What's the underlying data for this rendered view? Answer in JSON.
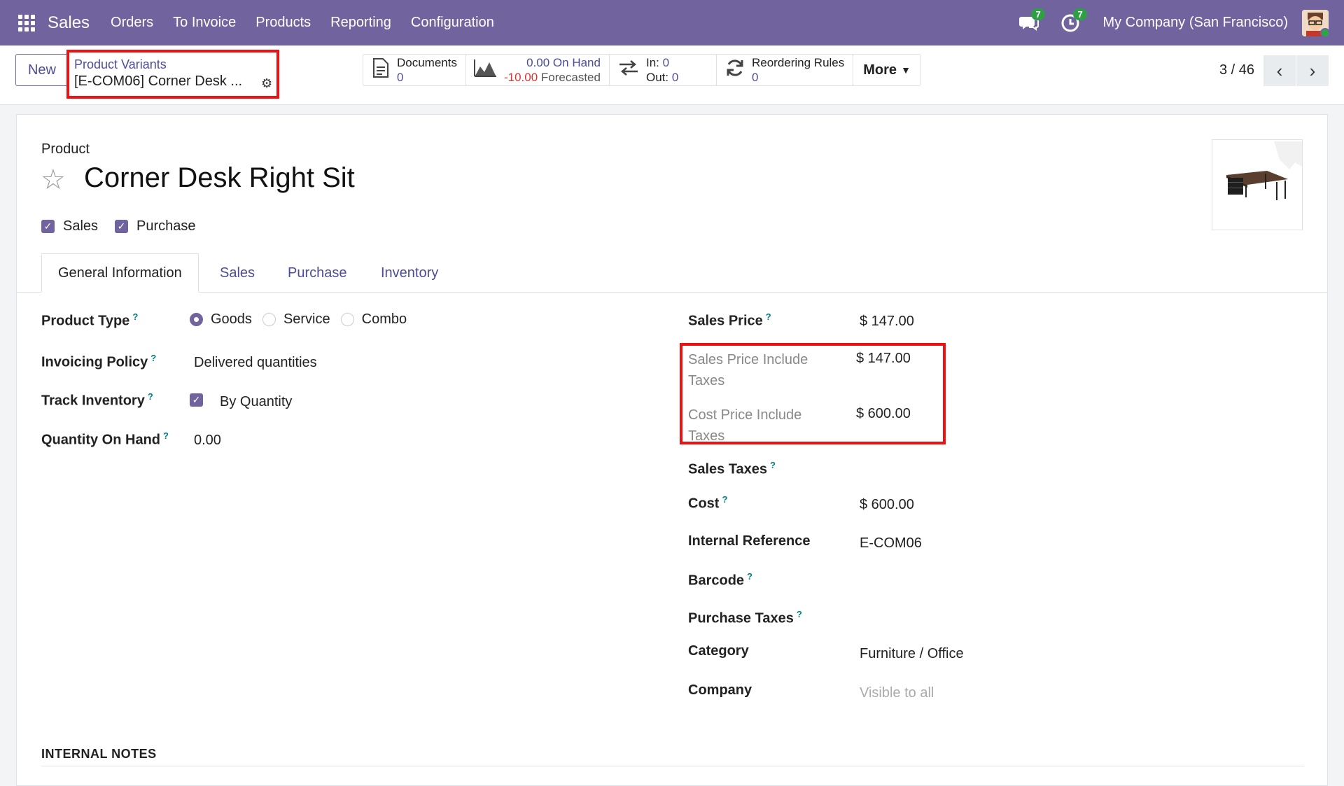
{
  "navbar": {
    "app_name": "Sales",
    "menu": [
      "Orders",
      "To Invoice",
      "Products",
      "Reporting",
      "Configuration"
    ],
    "messages_count": "7",
    "activities_count": "7",
    "company": "My Company (San Francisco)"
  },
  "control": {
    "new_label": "New",
    "breadcrumb_parent": "Product Variants",
    "breadcrumb_current": "[E-COM06] Corner Desk ...",
    "stats": {
      "documents_label": "Documents",
      "documents_value": "0",
      "on_hand_value": "0.00",
      "on_hand_label": "On Hand",
      "forecast_value": "-10.00",
      "forecast_label": "Forecasted",
      "in_label": "In:",
      "in_value": "0",
      "out_label": "Out:",
      "out_value": "0",
      "reordering_label": "Reordering Rules",
      "reordering_value": "0",
      "more_label": "More"
    },
    "pager": "3 / 46"
  },
  "form": {
    "type_label": "Product",
    "name": "Corner Desk Right Sit",
    "sales_check_label": "Sales",
    "purchase_check_label": "Purchase",
    "tabs": [
      "General Information",
      "Sales",
      "Purchase",
      "Inventory"
    ],
    "left": {
      "product_type_label": "Product Type",
      "product_type_options": [
        "Goods",
        "Service",
        "Combo"
      ],
      "product_type_selected": "Goods",
      "invoicing_policy_label": "Invoicing Policy",
      "invoicing_policy_value": "Delivered quantities",
      "track_inventory_label": "Track Inventory",
      "track_inventory_value": "By Quantity",
      "qty_on_hand_label": "Quantity On Hand",
      "qty_on_hand_value": "0.00"
    },
    "right": {
      "sales_price_label": "Sales Price",
      "sales_price_value": "$ 147.00",
      "sales_price_incl_label_1": "Sales Price Include",
      "sales_price_incl_label_2": "Taxes",
      "sales_price_incl_value": "$ 147.00",
      "cost_price_incl_label_1": "Cost Price Include",
      "cost_price_incl_label_2": "Taxes",
      "cost_price_incl_value": "$ 600.00",
      "sales_taxes_label": "Sales Taxes",
      "cost_label": "Cost",
      "cost_value": "$ 600.00",
      "internal_ref_label": "Internal Reference",
      "internal_ref_value": "E-COM06",
      "barcode_label": "Barcode",
      "purchase_taxes_label": "Purchase Taxes",
      "category_label": "Category",
      "category_value": "Furniture / Office",
      "company_label": "Company",
      "company_placeholder": "Visible to all"
    },
    "internal_notes_label": "INTERNAL NOTES"
  },
  "colors": {
    "navbar": "#71639e",
    "link": "#4c4c9a",
    "highlight": "#ee1111",
    "help": "#017e84"
  }
}
